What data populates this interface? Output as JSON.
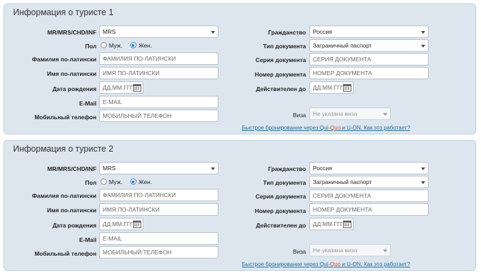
{
  "tourists": [
    {
      "title": "Информация о туристе 1",
      "labels": {
        "title_code": "MR/MRS/CHD/INF",
        "gender": "Пол",
        "last_name": "Фамилия по-латински",
        "first_name": "Имя по-латински",
        "birth_date": "Дата рождения",
        "email": "E-Mail",
        "phone": "Мобильный телефон",
        "citizenship": "Гражданство",
        "doc_type": "Тип документа",
        "doc_series": "Серия документа",
        "doc_number": "Номер документа",
        "valid_until": "Действителен до",
        "visa": "Виза"
      },
      "values": {
        "title_code": "MRS",
        "gender_male": "Муж.",
        "gender_female": "Жен.",
        "gender_selected": "female",
        "last_name_placeholder": "ФАМИЛИЯ ПО-ЛАТИНСКИ",
        "first_name_placeholder": "ИМЯ ПО-ЛАТИНСКИ",
        "birth_date_placeholder": "ДД.ММ.ГГГГ",
        "email_placeholder": "E-MAIL",
        "phone_placeholder": "МОБИЛЬНЫЙ ТЕЛЕФОН",
        "citizenship": "Россия",
        "doc_type": "Заграничный паспорт",
        "doc_series_placeholder": "СЕРИЯ ДОКУМЕНТА",
        "doc_number_placeholder": "НОМЕР ДОКУМЕНТА",
        "valid_until_placeholder": "ДД.ММ.ГГГГ",
        "visa": "Не указана виза"
      },
      "quick_link": {
        "before": "Быстрое бронирование через ",
        "qui": "Qui-",
        "quo": "Quo",
        "after": " и U-ON. Как это работает?"
      }
    },
    {
      "title": "Информация о туристе 2",
      "labels": {
        "title_code": "MR/MRS/CHD/INF",
        "gender": "Пол",
        "last_name": "Фамилия по-латински",
        "first_name": "Имя по-латински",
        "birth_date": "Дата рождения",
        "email": "E-Mail",
        "phone": "Мобильный телефон",
        "citizenship": "Гражданство",
        "doc_type": "Тип документа",
        "doc_series": "Серия документа",
        "doc_number": "Номер документа",
        "valid_until": "Действителен до",
        "visa": "Виза"
      },
      "values": {
        "title_code": "MRS",
        "gender_male": "Муж.",
        "gender_female": "Жен.",
        "gender_selected": "female",
        "last_name_placeholder": "ФАМИЛИЯ ПО-ЛАТИНСКИ",
        "first_name_placeholder": "ИМЯ ПО-ЛАТИНСКИ",
        "birth_date_placeholder": "ДД.ММ.ГГГГ",
        "email_placeholder": "E-MAIL",
        "phone_placeholder": "МОБИЛЬНЫЙ ТЕЛЕФОН",
        "citizenship": "Россия",
        "doc_type": "Заграничный паспорт",
        "doc_series_placeholder": "СЕРИЯ ДОКУМЕНТА",
        "doc_number_placeholder": "НОМЕР ДОКУМЕНТА",
        "valid_until_placeholder": "ДД.ММ.ГГГГ",
        "visa": "Не указана виза"
      },
      "quick_link": {
        "before": "Быстрое бронирование через ",
        "qui": "Qui-",
        "quo": "Quo",
        "after": " и U-ON. Как это работает?"
      }
    }
  ],
  "icons": {
    "calendar": "calendar-icon",
    "dropdown": "chevron-down-icon"
  },
  "colors": {
    "panel_bg": "#dde6ee",
    "radio_accent": "#2d7fd3",
    "link": "#2a6f9b",
    "quo_accent": "#d9532c"
  }
}
